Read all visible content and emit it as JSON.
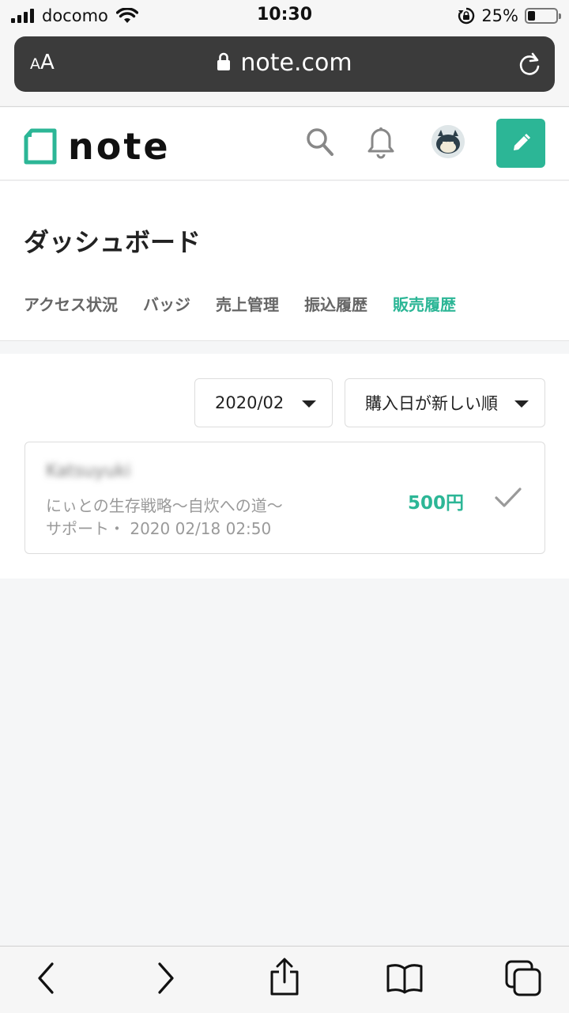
{
  "status": {
    "carrier": "docomo",
    "time": "10:30",
    "battery": "25%",
    "battery_level": 0.25
  },
  "browser": {
    "text_size_label_small": "A",
    "text_size_label_large": "A",
    "url": "note.com"
  },
  "header": {
    "logo_text": "note",
    "brand_color": "#2cb696"
  },
  "dashboard": {
    "title": "ダッシュボード",
    "tabs": [
      {
        "label": "アクセス状況",
        "active": false
      },
      {
        "label": "バッジ",
        "active": false
      },
      {
        "label": "売上管理",
        "active": false
      },
      {
        "label": "振込履歴",
        "active": false
      },
      {
        "label": "販売履歴",
        "active": true
      }
    ]
  },
  "filters": {
    "month": "2020/02",
    "sort": "購入日が新しい順"
  },
  "sales": [
    {
      "buyer": "Katsuyuki",
      "article": "にぃとの生存戦略〜自炊への道〜",
      "meta": "サポート・ 2020 02/18 02:50",
      "price": "500円"
    }
  ]
}
